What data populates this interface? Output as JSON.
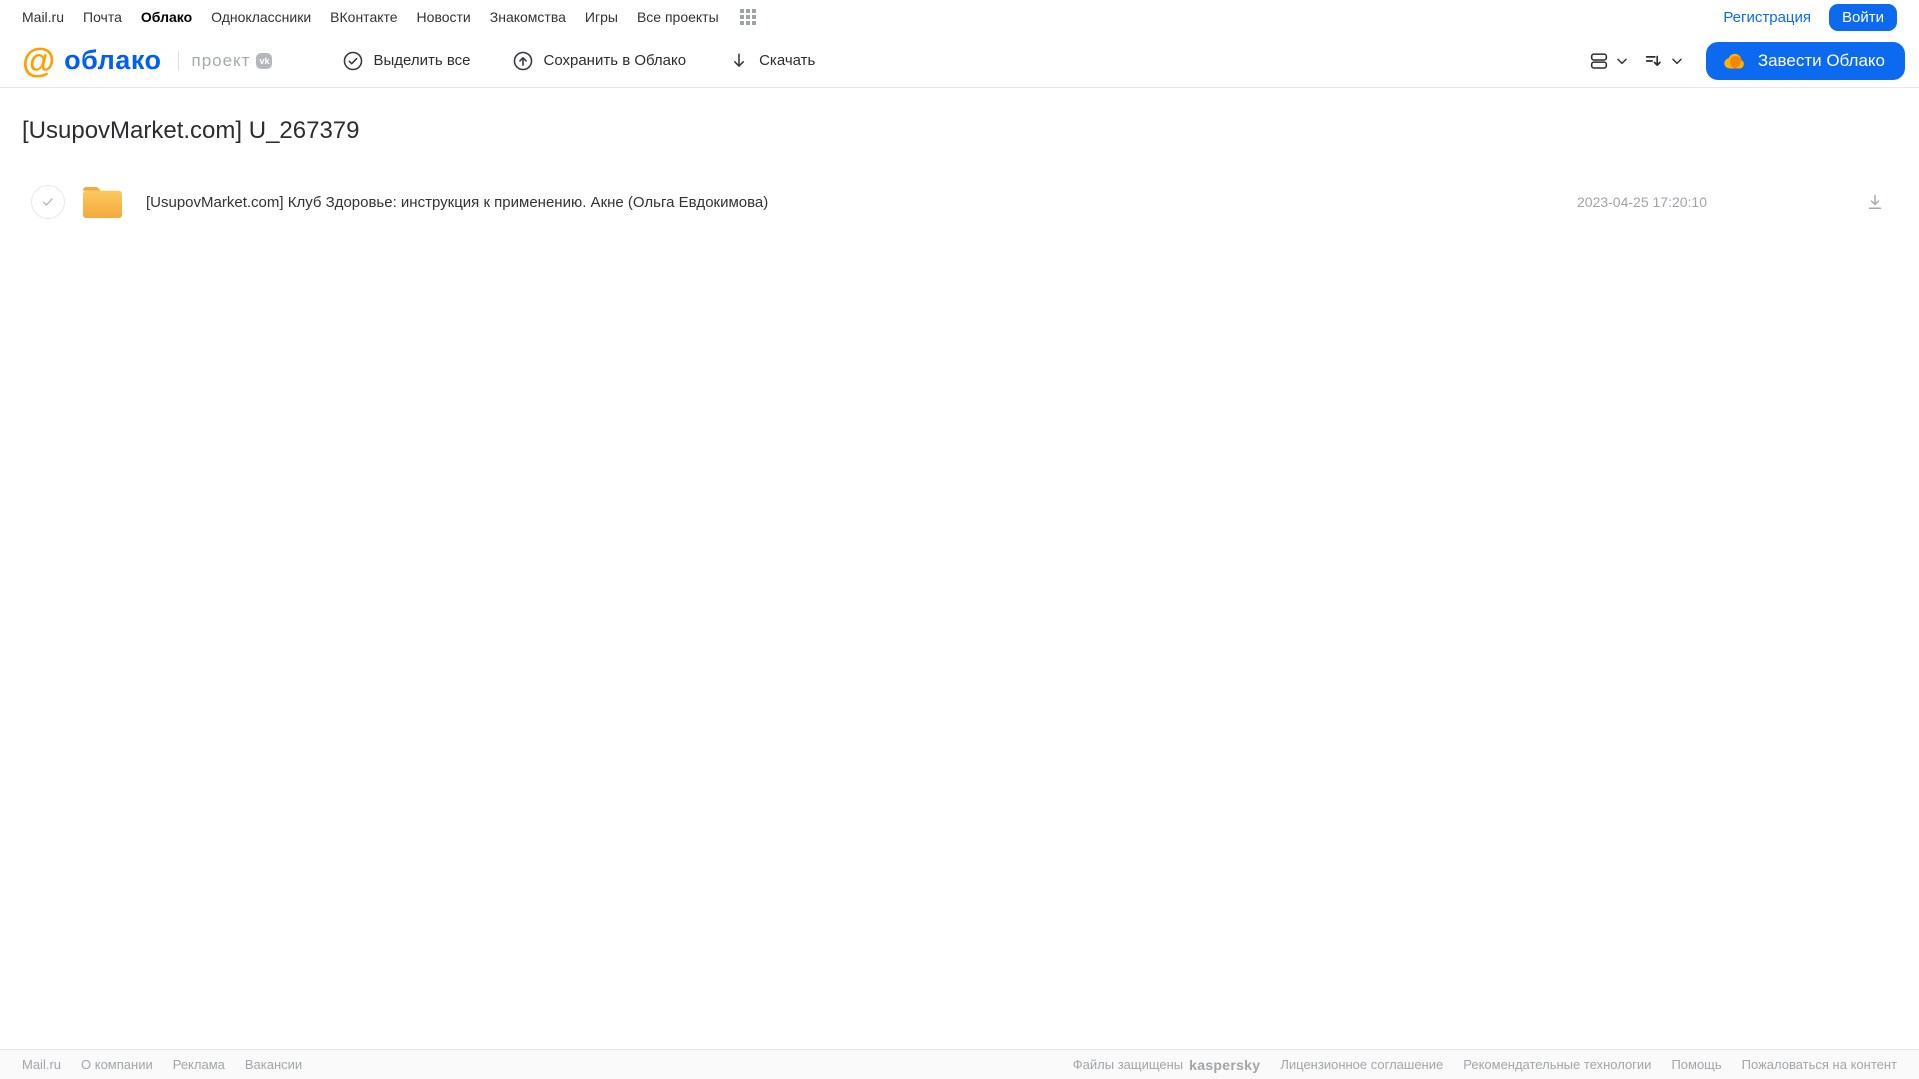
{
  "topnav": {
    "items": [
      "Mail.ru",
      "Почта",
      "Облако",
      "Одноклассники",
      "ВКонтакте",
      "Новости",
      "Знакомства",
      "Игры",
      "Все проекты"
    ],
    "registration_label": "Регистрация",
    "login_label": "Войти"
  },
  "header": {
    "logo_at": "@",
    "logo_text": "облако",
    "project_label": "проект",
    "vk_badge": "vk",
    "actions": [
      {
        "label": "Выделить все",
        "icon": "check-circle-icon"
      },
      {
        "label": "Сохранить в Облако",
        "icon": "upload-cloud-icon"
      },
      {
        "label": "Скачать",
        "icon": "download-arrow-icon"
      }
    ],
    "get_cloud_label": "Завести Облако"
  },
  "main": {
    "title": "[UsupovMarket.com] U_267379",
    "files": [
      {
        "type": "folder",
        "name": "[UsupovMarket.com] Клуб Здоровье: инструкция к применению. Акне (Ольга Евдокимова)",
        "date": "2023-04-25 17:20:10"
      }
    ]
  },
  "footer": {
    "left_links": [
      "Mail.ru",
      "О компании",
      "Реклама",
      "Вакансии"
    ],
    "protected_label": "Файлы защищены",
    "kaspersky_logo": "kaspersky",
    "right_links": [
      "Лицензионное соглашение",
      "Рекомендательные технологии",
      "Помощь",
      "Пожаловаться на контент"
    ]
  },
  "colors": {
    "accent_blue": "#0b6af0",
    "logo_orange": "#ff9e00",
    "logo_blue": "#005ff9",
    "folder_yellow": "#f7b84e",
    "kaspersky_teal": "#00806c"
  }
}
